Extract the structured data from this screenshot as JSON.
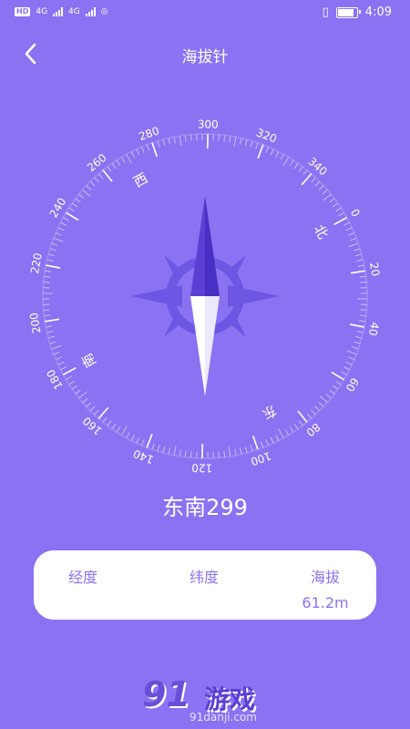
{
  "statusbar": {
    "time": "4:09",
    "badge": "HD",
    "net1": "4G",
    "net2": "4G"
  },
  "header": {
    "title": "海拔针"
  },
  "compass": {
    "heading_deg": 299,
    "degree_labels": [
      "0",
      "20",
      "40",
      "60",
      "80",
      "100",
      "120",
      "140",
      "160",
      "180",
      "200",
      "220",
      "240",
      "260",
      "280",
      "300",
      "320",
      "340"
    ],
    "cardinals": {
      "north": "北",
      "south": "南",
      "east": "东",
      "west": "西"
    }
  },
  "readout": {
    "direction": "东南299"
  },
  "info": {
    "longitude_label": "经度",
    "longitude_value": "",
    "latitude_label": "纬度",
    "latitude_value": "",
    "altitude_label": "海拔",
    "altitude_value": "61.2m"
  },
  "watermark": {
    "number": "91",
    "text": "游戏",
    "url": "91danji.com"
  },
  "colors": {
    "background": "#8b72f2",
    "needle_dark": "#5b3fd4",
    "rose": "#6e56e4",
    "card": "#ffffff"
  }
}
